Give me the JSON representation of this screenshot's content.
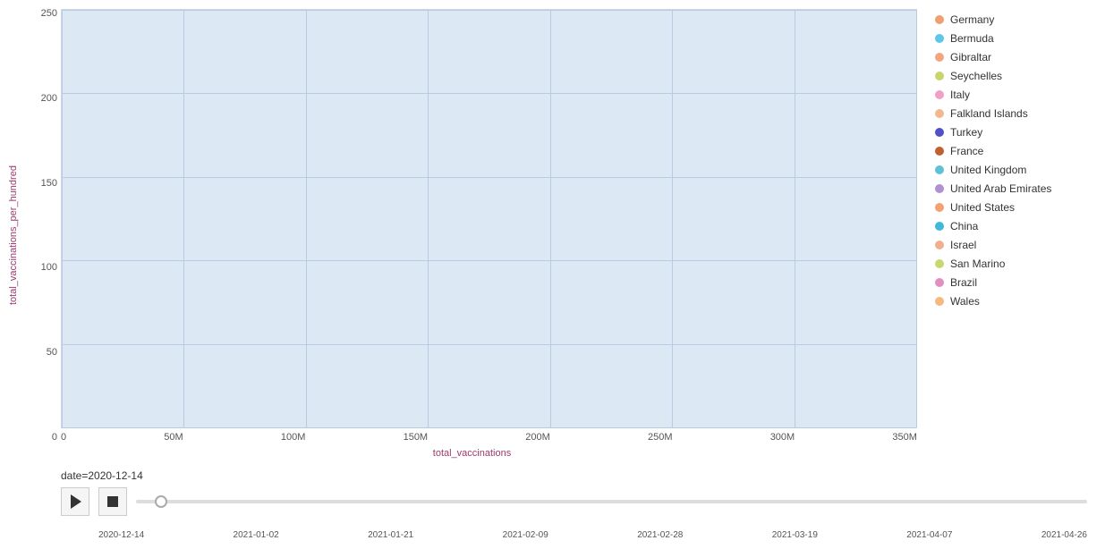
{
  "chart": {
    "y_axis_label": "total_vaccinations_per_hundred",
    "x_axis_label": "total_vaccinations",
    "y_ticks": [
      "250",
      "200",
      "150",
      "100",
      "50",
      "0"
    ],
    "x_ticks": [
      "0",
      "50M",
      "100M",
      "150M",
      "200M",
      "250M",
      "300M",
      "350M"
    ],
    "grid_h_count": 6,
    "grid_v_count": 8
  },
  "legend": {
    "items": [
      {
        "label": "Germany",
        "color": "#f0a070"
      },
      {
        "label": "Bermuda",
        "color": "#5bc8e8"
      },
      {
        "label": "Gibraltar",
        "color": "#f4a580"
      },
      {
        "label": "Seychelles",
        "color": "#c8d46e"
      },
      {
        "label": "Italy",
        "color": "#f0a0c8"
      },
      {
        "label": "Falkland Islands",
        "color": "#f4b890"
      },
      {
        "label": "Turkey",
        "color": "#5050c8"
      },
      {
        "label": "France",
        "color": "#c06030"
      },
      {
        "label": "United Kingdom",
        "color": "#60c0d8"
      },
      {
        "label": "United Arab Emirates",
        "color": "#b090d0"
      },
      {
        "label": "United States",
        "color": "#f4a070"
      },
      {
        "label": "China",
        "color": "#40b8d8"
      },
      {
        "label": "Israel",
        "color": "#f0b090"
      },
      {
        "label": "San Marino",
        "color": "#c8d870"
      },
      {
        "label": "Brazil",
        "color": "#e090c0"
      },
      {
        "label": "Wales",
        "color": "#f4b880"
      }
    ]
  },
  "controls": {
    "date_label": "date=2020-12-14",
    "play_label": "▶",
    "stop_label": "■",
    "timeline_dates": [
      "2020-12-14",
      "2021-01-02",
      "2021-01-21",
      "2021-02-09",
      "2021-02-28",
      "2021-03-19",
      "2021-04-07",
      "2021-04-26"
    ]
  }
}
